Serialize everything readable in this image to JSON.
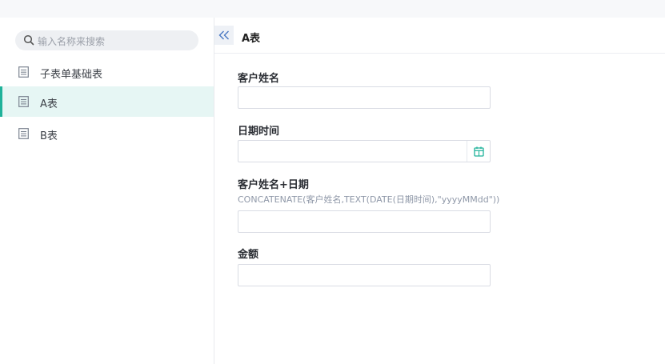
{
  "header": {
    "breadcrumb": ""
  },
  "sidebar": {
    "search_placeholder": "输入名称来搜索",
    "items": [
      {
        "label": "子表单基础表",
        "active": false
      },
      {
        "label": "A表",
        "active": true
      },
      {
        "label": "B表",
        "active": false
      }
    ]
  },
  "form": {
    "title": "A表",
    "fields": [
      {
        "label": "客户姓名",
        "value": ""
      },
      {
        "label": "日期时间",
        "value": ""
      },
      {
        "label": "客户姓名+日期",
        "formula": "CONCATENATE(客户姓名,TEXT(DATE(日期时间),\"yyyyMMdd\"))",
        "value": ""
      },
      {
        "label": "金额",
        "value": ""
      }
    ]
  },
  "colors": {
    "accent": "#1fb29a",
    "active_bg": "#e6f6f4"
  },
  "icons": {
    "search": "search-icon",
    "doc": "document-icon",
    "collapse": "double-chevron-left-icon",
    "calendar": "calendar-icon"
  }
}
